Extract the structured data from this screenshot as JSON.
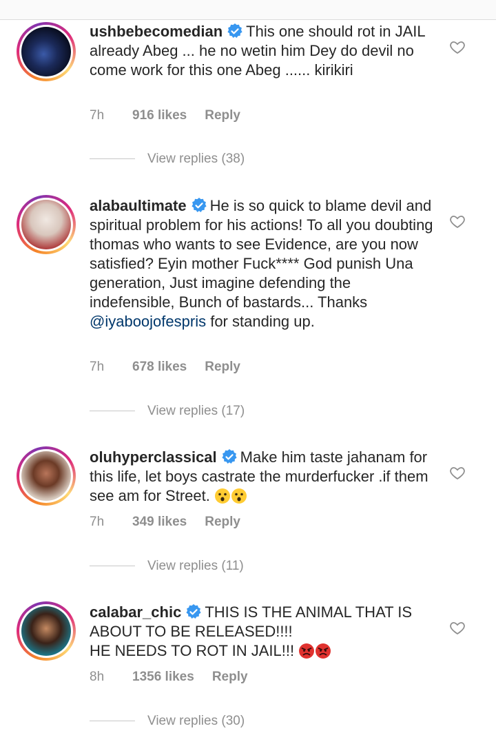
{
  "comments": [
    {
      "username": "ushbebecomedian",
      "text": "This one should rot in JAIL already Abeg ... he no wetin him Dey do devil no come work for this one Abeg ...... kirikiri",
      "time": "7h",
      "likes": "916 likes",
      "reply_label": "Reply",
      "view_replies": "View replies (38)",
      "avatar_icon": "profile-photo"
    },
    {
      "username": "alabaultimate",
      "text_before_mention": "He is so quick to blame devil and spiritual problem for his actions! To all you doubting thomas who wants to see Evidence, are you now satisfied? Eyin mother Fuck**** God punish Una generation, Just imagine defending the indefensible, Bunch of bastards... Thanks ",
      "mention": "@iyaboojofespris",
      "text_after_mention": " for standing up.",
      "time": "7h",
      "likes": "678 likes",
      "reply_label": "Reply",
      "view_replies": "View replies (17)",
      "avatar_icon": "profile-photo"
    },
    {
      "username": "oluhyperclassical",
      "text": "Make him taste jahanam for this life, let boys  castrate the murderfucker .if them see am for Street.",
      "emojis": [
        "astonished-face",
        "astonished-face"
      ],
      "time": "7h",
      "likes": "349 likes",
      "reply_label": "Reply",
      "view_replies": "View replies (11)",
      "avatar_icon": "profile-photo"
    },
    {
      "username": "calabar_chic",
      "text": "THIS IS THE ANIMAL THAT IS ABOUT TO BE RELEASED!!!!",
      "text_line2": "HE NEEDS TO ROT IN JAIL!!!",
      "emojis": [
        "angry-face",
        "angry-face"
      ],
      "time": "8h",
      "likes": "1356 likes",
      "reply_label": "Reply",
      "view_replies": "View replies (30)",
      "avatar_icon": "profile-photo"
    }
  ],
  "colors": {
    "verified_badge": "#3897f0",
    "mention": "#00376b",
    "secondary_text": "#8e8e8e",
    "primary_text": "#262626"
  },
  "icons": {
    "like": "heart-outline-icon",
    "verified": "verified-badge-icon"
  }
}
